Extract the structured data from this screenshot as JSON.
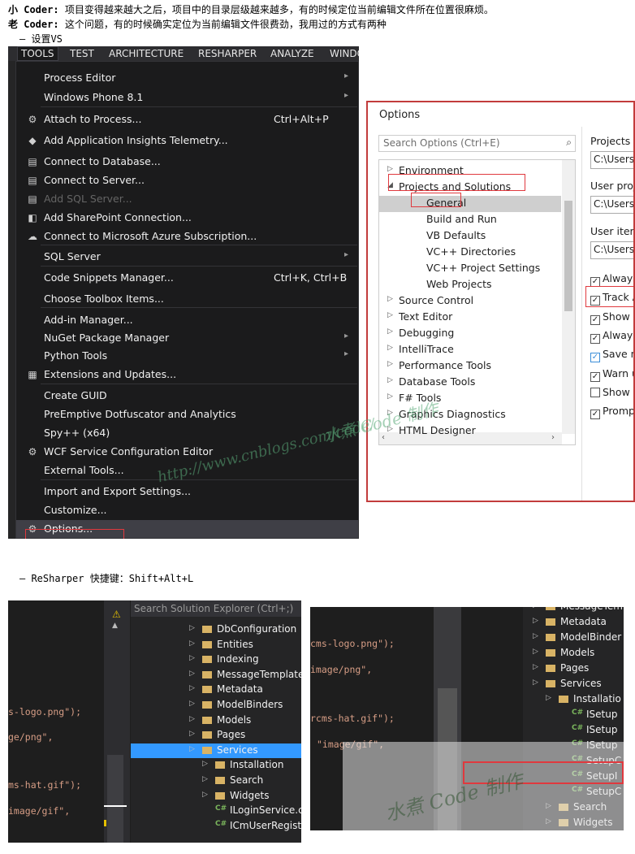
{
  "text": {
    "line1_speaker": "小 Coder:",
    "line1_body": "项目变得越来越大之后，项目中的目录层级越来越多，有的时候定位当前编辑文件所在位置很麻烦。",
    "line2_speaker": "老 Coder:",
    "line2_body": "这个问题，有的时候确实定位为当前编辑文件很费劲，我用过的方式有两种",
    "bullet1": "– 设置VS",
    "bullet2": "– ReSharper 快捷键：Shift+Alt+L"
  },
  "vs": {
    "menubar": [
      "TOOLS",
      "TEST",
      "ARCHITECTURE",
      "RESHARPER",
      "ANALYZE",
      "WINDO"
    ],
    "items": [
      {
        "label": "Process Editor",
        "shortcut": "",
        "arrow": "▸",
        "icon": ""
      },
      {
        "label": "Windows Phone 8.1",
        "shortcut": "",
        "arrow": "▸",
        "icon": ""
      },
      {
        "label": "Attach to Process...",
        "shortcut": "Ctrl+Alt+P",
        "arrow": "",
        "icon": "⚙"
      },
      {
        "label": "Add Application Insights Telemetry...",
        "shortcut": "",
        "arrow": "",
        "icon": "◆"
      },
      {
        "label": "Connect to Database...",
        "shortcut": "",
        "arrow": "",
        "icon": "▤"
      },
      {
        "label": "Connect to Server...",
        "shortcut": "",
        "arrow": "",
        "icon": "▤"
      },
      {
        "label": "Add SQL Server...",
        "shortcut": "",
        "arrow": "",
        "icon": "▤"
      },
      {
        "label": "Add SharePoint Connection...",
        "shortcut": "",
        "arrow": "",
        "icon": "◧"
      },
      {
        "label": "Connect to Microsoft Azure Subscription...",
        "shortcut": "",
        "arrow": "",
        "icon": "☁"
      },
      {
        "label": "SQL Server",
        "shortcut": "",
        "arrow": "▸",
        "icon": ""
      },
      {
        "label": "Code Snippets Manager...",
        "shortcut": "Ctrl+K, Ctrl+B",
        "arrow": "",
        "icon": ""
      },
      {
        "label": "Choose Toolbox Items...",
        "shortcut": "",
        "arrow": "",
        "icon": ""
      },
      {
        "label": "Add-in Manager...",
        "shortcut": "",
        "arrow": "",
        "icon": ""
      },
      {
        "label": "NuGet Package Manager",
        "shortcut": "",
        "arrow": "▸",
        "icon": ""
      },
      {
        "label": "Python Tools",
        "shortcut": "",
        "arrow": "▸",
        "icon": ""
      },
      {
        "label": "Extensions and Updates...",
        "shortcut": "",
        "arrow": "",
        "icon": "▦"
      },
      {
        "label": "Create GUID",
        "shortcut": "",
        "arrow": "",
        "icon": ""
      },
      {
        "label": "PreEmptive Dotfuscator and Analytics",
        "shortcut": "",
        "arrow": "",
        "icon": ""
      },
      {
        "label": "Spy++ (x64)",
        "shortcut": "",
        "arrow": "",
        "icon": ""
      },
      {
        "label": "WCF Service Configuration Editor",
        "shortcut": "",
        "arrow": "",
        "icon": "⚙"
      },
      {
        "label": "External Tools...",
        "shortcut": "",
        "arrow": "",
        "icon": ""
      },
      {
        "label": "Import and Export Settings...",
        "shortcut": "",
        "arrow": "",
        "icon": ""
      },
      {
        "label": "Customize...",
        "shortcut": "",
        "arrow": "",
        "icon": ""
      },
      {
        "label": "Options...",
        "shortcut": "",
        "arrow": "",
        "icon": "⚙"
      }
    ]
  },
  "watermark": {
    "line1": "水煮 Code 制作",
    "line2": "http://www.cnblogs.com/code/"
  },
  "options": {
    "title": "Options",
    "search_placeholder": "Search Options (Ctrl+E)",
    "tree": [
      {
        "label": "Environment",
        "level": 0,
        "expander": "▷"
      },
      {
        "label": "Projects and Solutions",
        "level": 0,
        "expander": "◢"
      },
      {
        "label": "General",
        "level": 1,
        "expander": ""
      },
      {
        "label": "Build and Run",
        "level": 1,
        "expander": ""
      },
      {
        "label": "VB Defaults",
        "level": 1,
        "expander": ""
      },
      {
        "label": "VC++ Directories",
        "level": 1,
        "expander": ""
      },
      {
        "label": "VC++ Project Settings",
        "level": 1,
        "expander": ""
      },
      {
        "label": "Web Projects",
        "level": 1,
        "expander": ""
      },
      {
        "label": "Source Control",
        "level": 0,
        "expander": "▷"
      },
      {
        "label": "Text Editor",
        "level": 0,
        "expander": "▷"
      },
      {
        "label": "Debugging",
        "level": 0,
        "expander": "▷"
      },
      {
        "label": "IntelliTrace",
        "level": 0,
        "expander": "▷"
      },
      {
        "label": "Performance Tools",
        "level": 0,
        "expander": "▷"
      },
      {
        "label": "Database Tools",
        "level": 0,
        "expander": "▷"
      },
      {
        "label": "F# Tools",
        "level": 0,
        "expander": "▷"
      },
      {
        "label": "Graphics Diagnostics",
        "level": 0,
        "expander": "▷"
      },
      {
        "label": "HTML Designer",
        "level": 0,
        "expander": "▷"
      }
    ],
    "right_labels": [
      "Projects lo",
      "User proj",
      "User item"
    ],
    "right_values": [
      "C:\\Users\\",
      "C:\\Users\\",
      "C:\\Users\\"
    ],
    "checkboxes": [
      {
        "label": "Always",
        "checked": "✓"
      },
      {
        "label": "Track A",
        "checked": "✓"
      },
      {
        "label": "Show a",
        "checked": "✓"
      },
      {
        "label": "Always",
        "checked": "✓"
      },
      {
        "label": "Save ne",
        "checked": "✓"
      },
      {
        "label": "Warn u",
        "checked": "✓"
      },
      {
        "label": "Show C",
        "checked": ""
      },
      {
        "label": "Prompt",
        "checked": "✓"
      }
    ]
  },
  "explorer1": {
    "search_placeholder": "Search Solution Explorer (Ctrl+;)",
    "code_lines": [
      "s-logo.png\");",
      "ge/png\",",
      "ms-hat.gif\");",
      "image/gif\","
    ],
    "nodes": [
      {
        "label": "DbConfiguration",
        "kind": "folder",
        "indent": 0
      },
      {
        "label": "Entities",
        "kind": "folder",
        "indent": 0
      },
      {
        "label": "Indexing",
        "kind": "folder",
        "indent": 0
      },
      {
        "label": "MessageTemplates",
        "kind": "folder",
        "indent": 0
      },
      {
        "label": "Metadata",
        "kind": "folder",
        "indent": 0
      },
      {
        "label": "ModelBinders",
        "kind": "folder",
        "indent": 0
      },
      {
        "label": "Models",
        "kind": "folder",
        "indent": 0
      },
      {
        "label": "Pages",
        "kind": "folder",
        "indent": 0
      },
      {
        "label": "Services",
        "kind": "folder",
        "indent": 0
      },
      {
        "label": "Installation",
        "kind": "folder",
        "indent": 1
      },
      {
        "label": "Search",
        "kind": "folder",
        "indent": 1
      },
      {
        "label": "Widgets",
        "kind": "folder",
        "indent": 1
      },
      {
        "label": "ILoginService.cs",
        "kind": "cs",
        "indent": 1
      },
      {
        "label": "ICmUserRegisterer",
        "kind": "cs",
        "indent": 1
      }
    ]
  },
  "explorer2": {
    "code_lines": [
      "cms-logo.png\");",
      "image/png\",",
      "rcms-hat.gif\");",
      "\"image/gif\","
    ],
    "nodes": [
      {
        "label": "MessageTem",
        "kind": "folder",
        "indent": 0
      },
      {
        "label": "Metadata",
        "kind": "folder",
        "indent": 0
      },
      {
        "label": "ModelBinder",
        "kind": "folder",
        "indent": 0
      },
      {
        "label": "Models",
        "kind": "folder",
        "indent": 0
      },
      {
        "label": "Pages",
        "kind": "folder",
        "indent": 0
      },
      {
        "label": "Services",
        "kind": "folder",
        "indent": 0
      },
      {
        "label": "Installatio",
        "kind": "folder",
        "indent": 1
      },
      {
        "label": "ISetup",
        "kind": "cs",
        "indent": 2
      },
      {
        "label": "ISetup",
        "kind": "cs",
        "indent": 2
      },
      {
        "label": "ISetup",
        "kind": "cs",
        "indent": 2
      },
      {
        "label": "SetupC",
        "kind": "cs",
        "indent": 2
      },
      {
        "label": "SetupI",
        "kind": "cs",
        "indent": 2
      },
      {
        "label": "SetupC",
        "kind": "cs",
        "indent": 2
      },
      {
        "label": "Search",
        "kind": "folder",
        "indent": 1
      },
      {
        "label": "Widgets",
        "kind": "folder",
        "indent": 1
      }
    ]
  }
}
